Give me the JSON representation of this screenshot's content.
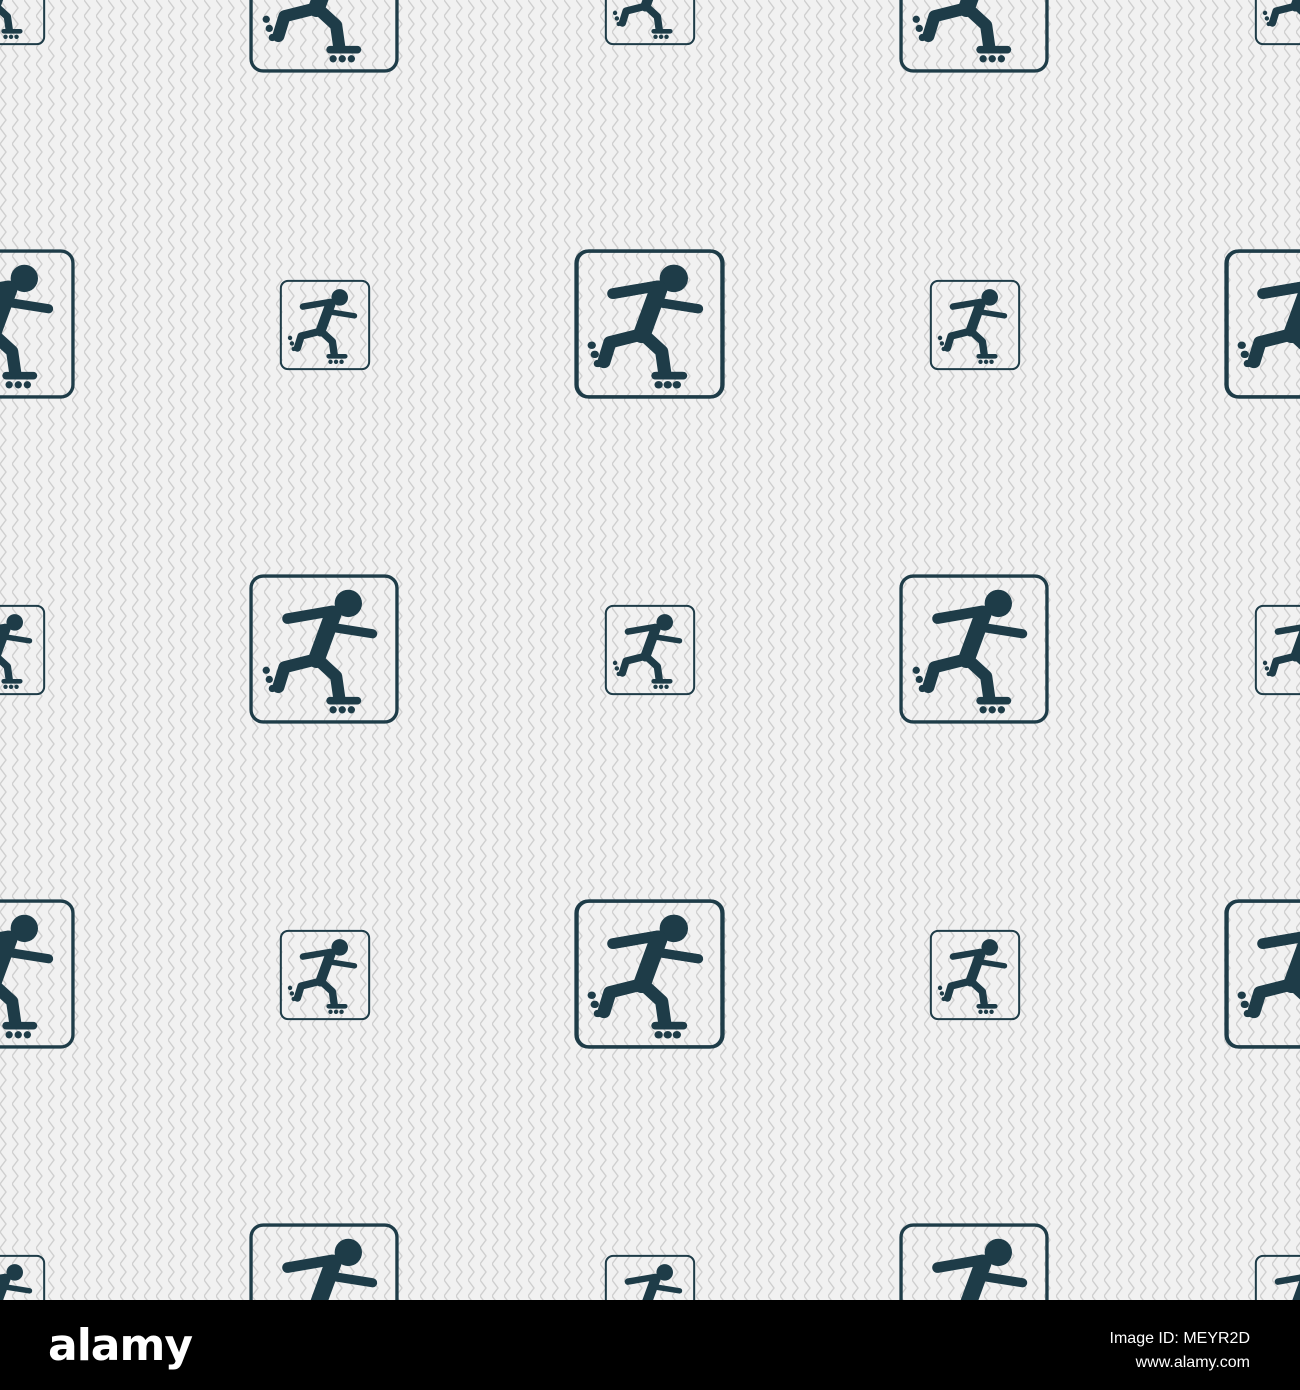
{
  "pattern": {
    "background_color": "#f1f1f1",
    "stroke_color": "#cfcfcf",
    "icon_color": "#1e3c48",
    "icon": "inline-skater-icon"
  },
  "watermark": {
    "brand": "alamy",
    "image_id": "Image ID: MEYR2D",
    "site": "www.alamy.com"
  }
}
